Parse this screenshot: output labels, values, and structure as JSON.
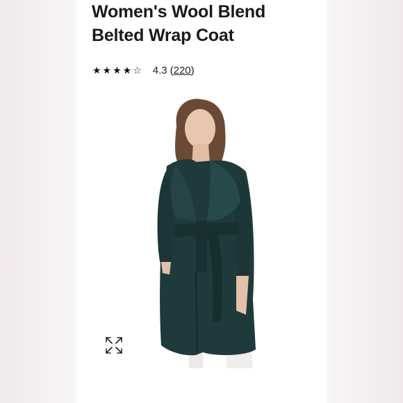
{
  "product": {
    "title_line1": "Women's Wool Blend",
    "title_line2": "Belted Wrap Coat",
    "rating": {
      "stars_glyphs": "★★★★☆",
      "value": "4.3",
      "review_open": "(",
      "review_count": "220",
      "review_close": ")"
    },
    "image": {
      "coat_color": "#1f3a3b",
      "icons": [
        "expand-icon"
      ]
    }
  }
}
